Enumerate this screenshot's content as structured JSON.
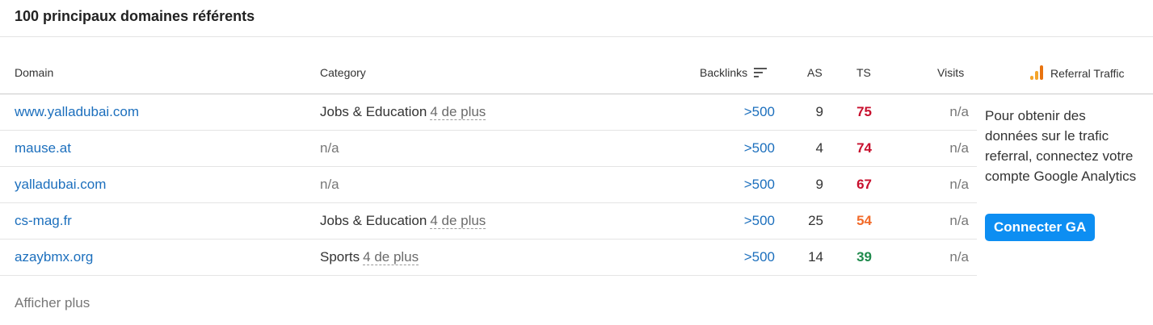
{
  "title": "100 principaux domaines référents",
  "columns": {
    "domain": "Domain",
    "category": "Category",
    "backlinks": "Backlinks",
    "as": "AS",
    "ts": "TS",
    "visits": "Visits",
    "referral": "Referral Traffic"
  },
  "rows": [
    {
      "domain": "www.yalladubai.com",
      "category": "Jobs & Education",
      "more": "4 de plus",
      "backlinks": ">500",
      "as": "9",
      "ts": "75",
      "ts_color": "#c8102e",
      "visits": "n/a"
    },
    {
      "domain": "mause.at",
      "category": "n/a",
      "more": "",
      "backlinks": ">500",
      "as": "4",
      "ts": "74",
      "ts_color": "#c8102e",
      "visits": "n/a"
    },
    {
      "domain": "yalladubai.com",
      "category": "n/a",
      "more": "",
      "backlinks": ">500",
      "as": "9",
      "ts": "67",
      "ts_color": "#c8102e",
      "visits": "n/a"
    },
    {
      "domain": "cs-mag.fr",
      "category": "Jobs & Education",
      "more": "4 de plus",
      "backlinks": ">500",
      "as": "25",
      "ts": "54",
      "ts_color": "#f26b2a",
      "visits": "n/a"
    },
    {
      "domain": "azaybmx.org",
      "category": "Sports",
      "more": "4 de plus",
      "backlinks": ">500",
      "as": "14",
      "ts": "39",
      "ts_color": "#1f8a4c",
      "visits": "n/a"
    }
  ],
  "referral_panel": {
    "message": "Pour obtenir des données sur le trafic referral, connectez votre compte Google Analytics",
    "button": "Connecter GA"
  },
  "show_more": "Afficher plus",
  "icons": {
    "sort": "sort-descending-icon",
    "referral": "bar-chart-icon"
  }
}
